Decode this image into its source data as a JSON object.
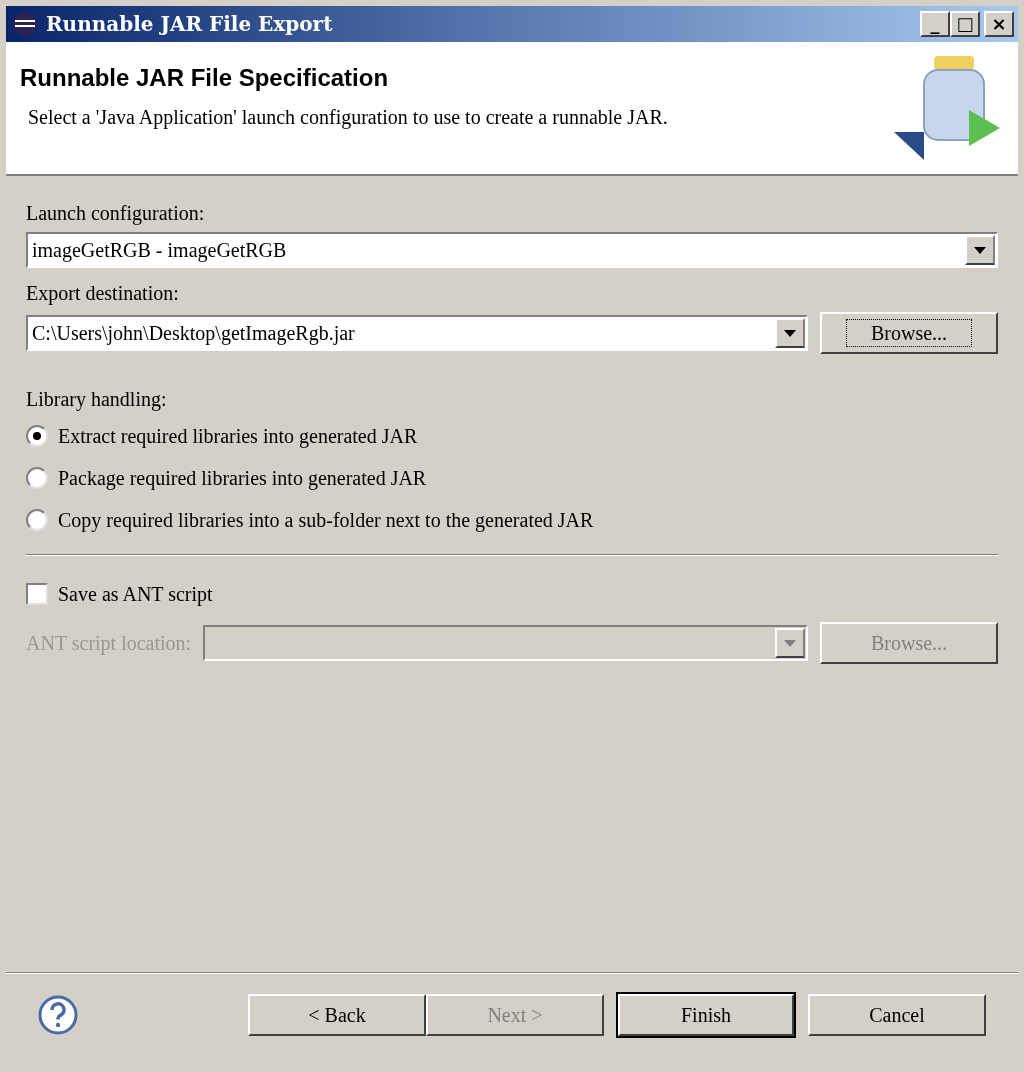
{
  "window": {
    "title": "Runnable JAR File Export",
    "controls": [
      "_",
      "□",
      "×"
    ]
  },
  "header": {
    "title": "Runnable JAR File Specification",
    "description": "Select a 'Java Application' launch configuration to use to create a runnable JAR."
  },
  "launch_configuration": {
    "label": "Launch configuration:",
    "value": "imageGetRGB - imageGetRGB"
  },
  "export_destination": {
    "label": "Export destination:",
    "value": "C:\\Users\\john\\Desktop\\getImageRgb.jar",
    "button": "Browse..."
  },
  "library_handling": {
    "label": "Library handling:",
    "options": [
      {
        "label": "Extract required libraries into generated JAR",
        "selected": true
      },
      {
        "label": "Package required libraries into generated JAR",
        "selected": false
      },
      {
        "label": "Copy required libraries into a sub-folder next to the generated JAR",
        "selected": false
      }
    ]
  },
  "save_ant": {
    "label": "Save as ANT script",
    "checked": false
  },
  "ant_location": {
    "label": "ANT script location:",
    "button": "Browse...",
    "disabled": true
  },
  "buttons": [
    {
      "label": "< Back",
      "disabled": false,
      "default": false
    },
    {
      "label": "Next >",
      "disabled": true,
      "default": false
    },
    {
      "label": "Finish",
      "disabled": false,
      "default": true
    },
    {
      "label": "Cancel",
      "disabled": false,
      "default": false
    }
  ]
}
